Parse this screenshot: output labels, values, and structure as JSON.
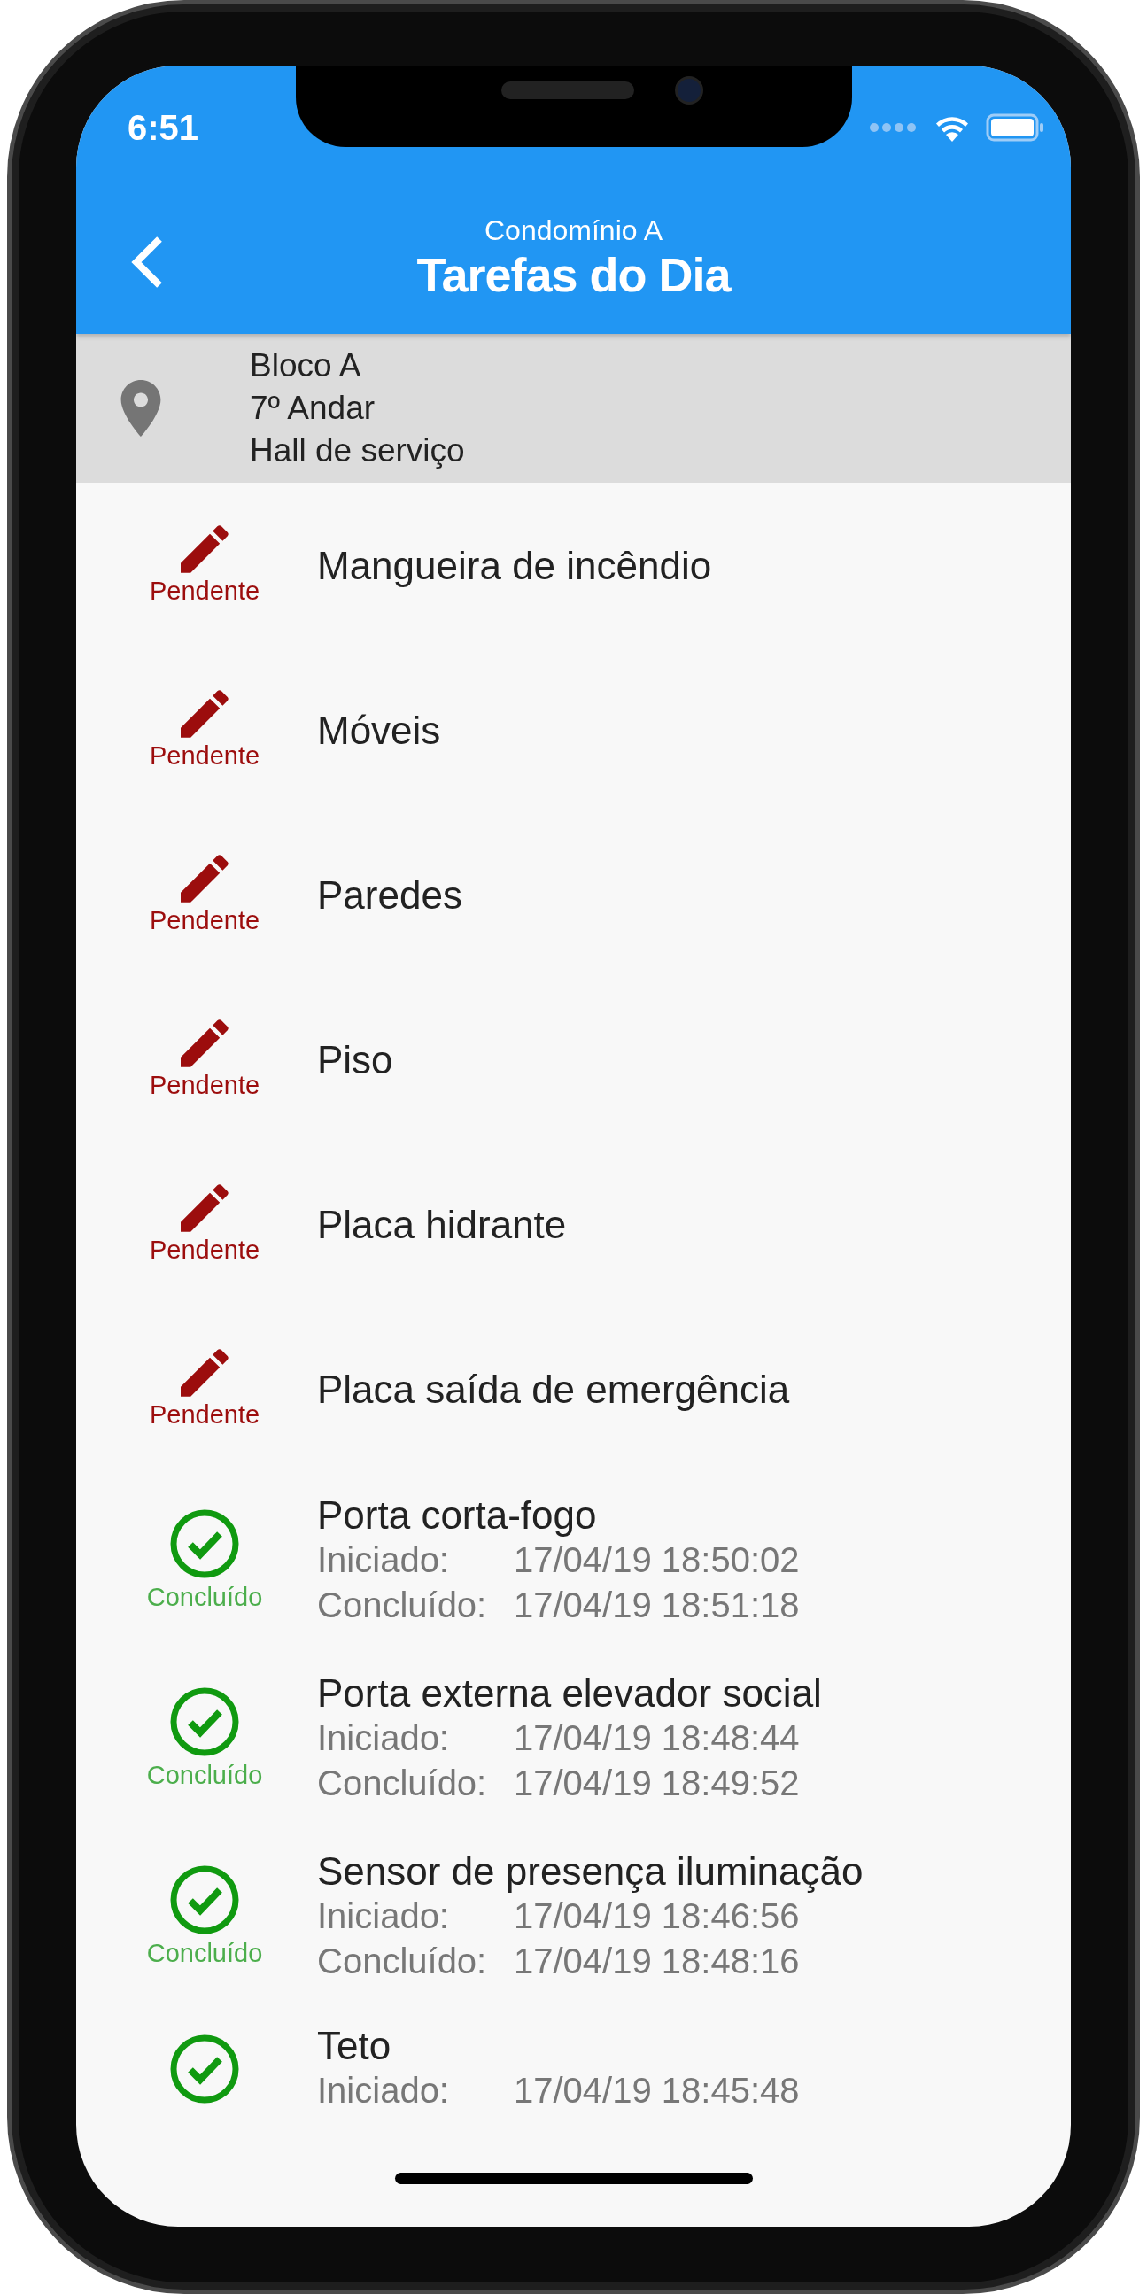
{
  "status_bar": {
    "time": "6:51"
  },
  "header": {
    "subtitle": "Condomínio A",
    "title": "Tarefas do Dia"
  },
  "location": {
    "lines": [
      "Bloco A",
      "7º Andar",
      "Hall de serviço"
    ]
  },
  "tasks": [
    {
      "kind": "pending",
      "status": "Pendente",
      "name": "Mangueira de incêndio"
    },
    {
      "kind": "pending",
      "status": "Pendente",
      "name": "Móveis"
    },
    {
      "kind": "pending",
      "status": "Pendente",
      "name": "Paredes"
    },
    {
      "kind": "pending",
      "status": "Pendente",
      "name": "Piso"
    },
    {
      "kind": "pending",
      "status": "Pendente",
      "name": "Placa hidrante"
    },
    {
      "kind": "pending",
      "status": "Pendente",
      "name": "Placa saída de emergência"
    },
    {
      "kind": "done",
      "status": "Concluído",
      "name": "Porta corta-fogo",
      "started_label": "Iniciado:",
      "started": "17/04/19 18:50:02",
      "finished_label": "Concluído:",
      "finished": "17/04/19 18:51:18"
    },
    {
      "kind": "done",
      "status": "Concluído",
      "name": "Porta externa elevador social",
      "started_label": "Iniciado:",
      "started": "17/04/19 18:48:44",
      "finished_label": "Concluído:",
      "finished": "17/04/19 18:49:52"
    },
    {
      "kind": "done",
      "status": "Concluído",
      "name": "Sensor de presença iluminação",
      "started_label": "Iniciado:",
      "started": "17/04/19 18:46:56",
      "finished_label": "Concluído:",
      "finished": "17/04/19 18:48:16"
    },
    {
      "kind": "done",
      "name": "Teto",
      "started_label": "Iniciado:",
      "started": "17/04/19 18:45:48"
    }
  ]
}
